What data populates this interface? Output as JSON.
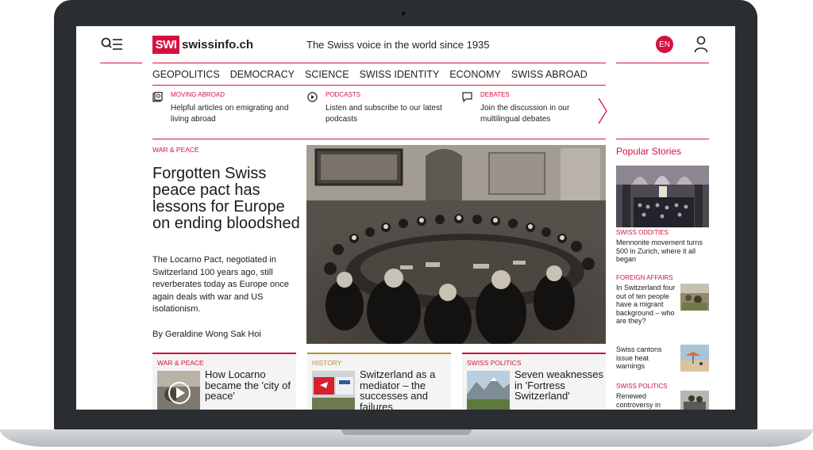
{
  "header": {
    "logo_mark": "SWI",
    "logo_text": "swissinfo.ch",
    "tagline": "The Swiss voice in the world since 1935",
    "language": "EN"
  },
  "nav": {
    "items": [
      "GEOPOLITICS",
      "DEMOCRACY",
      "SCIENCE",
      "SWISS IDENTITY",
      "ECONOMY",
      "SWISS ABROAD"
    ]
  },
  "promos": [
    {
      "label": "MOVING ABROAD",
      "text": "Helpful articles on emigrating and living abroad",
      "icon": "passport-icon"
    },
    {
      "label": "PODCASTS",
      "text": "Listen and subscribe to our latest podcasts",
      "icon": "play-icon"
    },
    {
      "label": "DEBATES",
      "text": "Join the discussion in our multilingual debates",
      "icon": "chat-icon"
    }
  ],
  "hero": {
    "category": "WAR & PEACE",
    "headline": "Forgotten Swiss peace pact has lessons for Europe on ending bloodshed",
    "lead": "The Locarno Pact, negotiated in Switzerland 100 years ago, still reverberates today as Europe once again deals with war and US isolationism.",
    "byline": "By Geraldine Wong Sak Hoi"
  },
  "popular": {
    "title": "Popular Stories",
    "items": [
      {
        "category": "SWISS ODDITIES",
        "text": "Mennonite movement turns 500 in Zurich, where it all began"
      },
      {
        "category": "FOREIGN AFFAIRS",
        "text": "In Switzerland four out of ten people have a migrant background – who are they?"
      },
      {
        "category": "",
        "text": "Swiss cantons issue heat warnings"
      },
      {
        "category": "SWISS POLITICS",
        "text": "Renewed controversy in"
      }
    ]
  },
  "cards": [
    {
      "category": "WAR & PEACE",
      "title": "How Locarno became the 'city of peace'",
      "color": "#d5113f"
    },
    {
      "category": "HISTORY",
      "title": "Switzerland as a mediator – the successes and failures",
      "color": "#b8912e"
    },
    {
      "category": "SWISS POLITICS",
      "title": "Seven weaknesses in 'Fortress Switzerland'",
      "color": "#d5113f"
    }
  ],
  "colors": {
    "brand": "#d5113f",
    "history": "#b8912e"
  }
}
